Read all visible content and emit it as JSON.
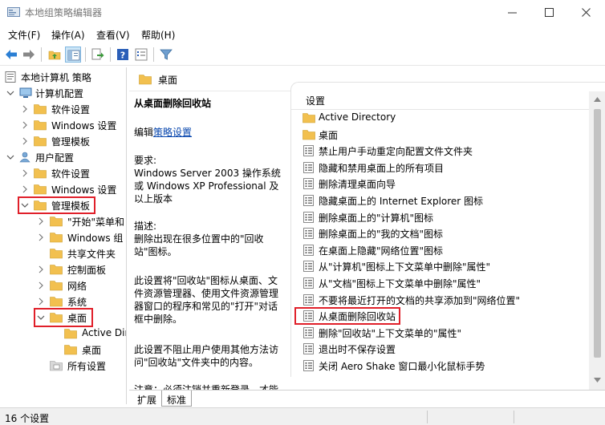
{
  "window": {
    "title": "本地组策略编辑器"
  },
  "menu": [
    {
      "label": "文件(F)"
    },
    {
      "label": "操作(A)"
    },
    {
      "label": "查看(V)"
    },
    {
      "label": "帮助(H)"
    }
  ],
  "toolbar": {
    "buttons": [
      "back-arrow-icon",
      "forward-arrow-icon",
      "up-folder-icon",
      "show-hide-tree-icon",
      "export-list-icon",
      "help-icon",
      "properties-icon",
      "filter-icon"
    ]
  },
  "tree": {
    "items": [
      {
        "label": "本地计算机 策略"
      },
      {
        "label": "计算机配置"
      },
      {
        "label": "软件设置"
      },
      {
        "label": "Windows 设置"
      },
      {
        "label": "管理模板"
      },
      {
        "label": "用户配置"
      },
      {
        "label": "软件设置"
      },
      {
        "label": "Windows 设置"
      },
      {
        "label": "管理模板"
      },
      {
        "label": "\"开始\"菜单和"
      },
      {
        "label": "Windows 组"
      },
      {
        "label": "共享文件夹"
      },
      {
        "label": "控制面板"
      },
      {
        "label": "网络"
      },
      {
        "label": "系统"
      },
      {
        "label": "桌面"
      },
      {
        "label": "Active Dir"
      },
      {
        "label": "桌面"
      },
      {
        "label": "所有设置"
      }
    ]
  },
  "content": {
    "header": "桌面",
    "column_header": "设置"
  },
  "description": {
    "title": "从桌面删除回收站",
    "edit_prefix": "编辑",
    "edit_link": "策略设置",
    "requirements_label": "要求:",
    "requirements_text": "Windows Server 2003 操作系统或 Windows XP Professional 及以上版本",
    "desc_label": "描述:",
    "desc_text": "删除出现在很多位置中的\"回收站\"图标。",
    "desc_p2": "此设置将\"回收站\"图标从桌面、文件资源管理器、使用文件资源管理器窗口的程序和常见的\"打开\"对话框中删除。",
    "desc_p3": "此设置不阻止用户使用其他方法访问\"回收站\"文件夹中的内容。",
    "desc_p4": "注意：必须注销并重新登录，才能"
  },
  "settings": [
    {
      "label": "Active Directory",
      "type": "folder"
    },
    {
      "label": "桌面",
      "type": "folder"
    },
    {
      "label": "禁止用户手动重定向配置文件文件夹",
      "type": "setting"
    },
    {
      "label": "隐藏和禁用桌面上的所有项目",
      "type": "setting"
    },
    {
      "label": "删除清理桌面向导",
      "type": "setting"
    },
    {
      "label": "隐藏桌面上的 Internet Explorer 图标",
      "type": "setting"
    },
    {
      "label": "删除桌面上的\"计算机\"图标",
      "type": "setting"
    },
    {
      "label": "删除桌面上的\"我的文档\"图标",
      "type": "setting"
    },
    {
      "label": "在桌面上隐藏\"网络位置\"图标",
      "type": "setting"
    },
    {
      "label": "从\"计算机\"图标上下文菜单中删除\"属性\"",
      "type": "setting"
    },
    {
      "label": "从\"文档\"图标上下文菜单中删除\"属性\"",
      "type": "setting"
    },
    {
      "label": "不要将最近打开的文档的共享添加到\"网络位置\"",
      "type": "setting"
    },
    {
      "label": "从桌面删除回收站",
      "type": "setting",
      "selected": true
    },
    {
      "label": "删除\"回收站\"上下文菜单的\"属性\"",
      "type": "setting"
    },
    {
      "label": "退出时不保存设置",
      "type": "setting"
    },
    {
      "label": "关闭 Aero Shake 窗口最小化鼠标手势",
      "type": "setting"
    }
  ],
  "tabs": [
    {
      "label": "扩展"
    },
    {
      "label": "标准"
    }
  ],
  "status": {
    "text": "16 个设置"
  },
  "colors": {
    "highlight_border": "#e0202a",
    "folder": "#f2c04f",
    "link": "#0645ad"
  }
}
